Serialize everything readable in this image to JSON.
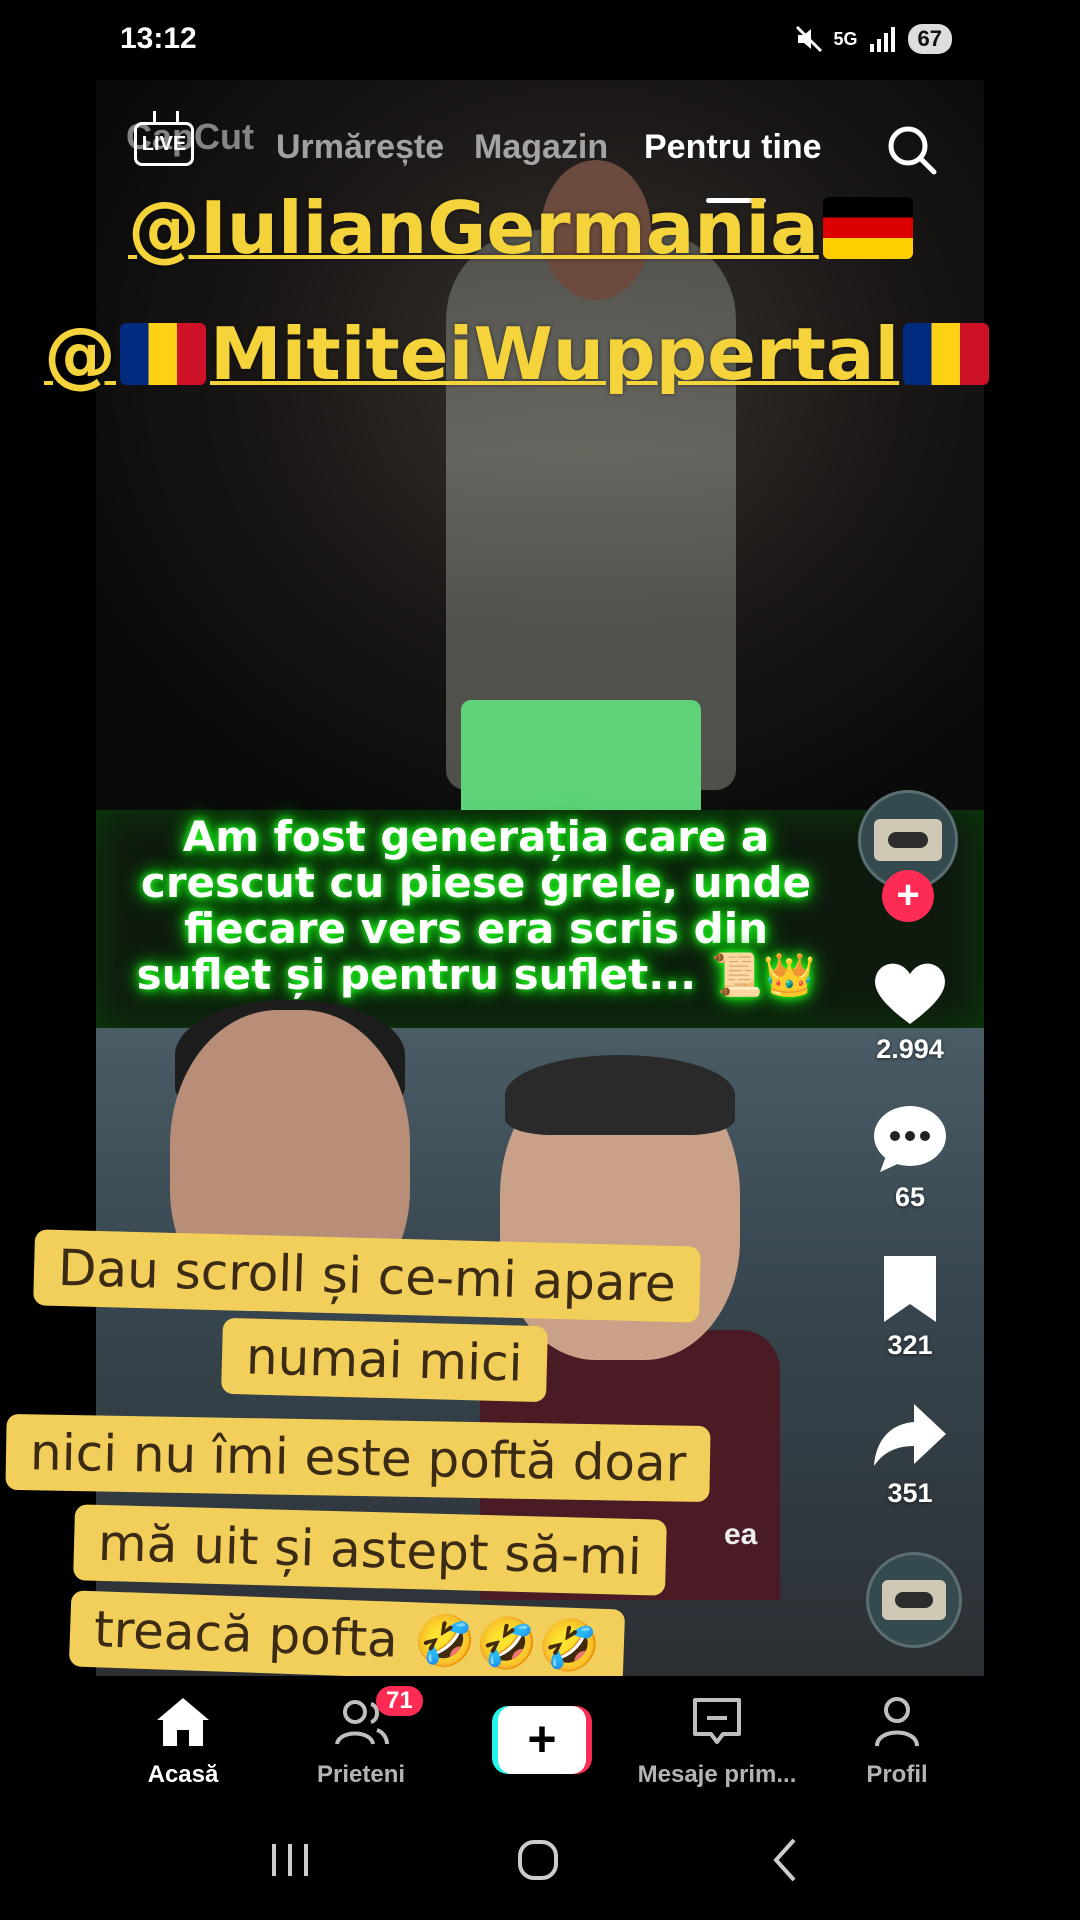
{
  "status_bar": {
    "time": "13:12",
    "network": "5G",
    "battery": "67"
  },
  "top_nav": {
    "watermark": "CapCut",
    "live_label": "LIVE",
    "tabs": [
      {
        "label": "Urmărește"
      },
      {
        "label": "Magazin"
      },
      {
        "label": "Pentru tine",
        "active": true
      }
    ]
  },
  "overlay": {
    "mention1": "@IulianGermania",
    "mention2": "@",
    "mention2_name": "MititeiWuppertal",
    "glow_caption": [
      "Am fost generația care a",
      "crescut cu piese grele, unde",
      "fiecare vers era scris din",
      "suflet și pentru suflet... 📜👑"
    ],
    "partial_text": "ea",
    "yellow_caption": [
      "Dau scroll și ce-mi apare",
      "numai mici",
      "nici nu îmi este poftă doar",
      "mă uit și astept să-mi",
      "treacă pofta 🤣🤣🤣"
    ]
  },
  "rail": {
    "likes": "2.994",
    "comments": "65",
    "saves": "321",
    "shares": "351"
  },
  "bottom_nav": {
    "home": "Acasă",
    "friends": "Prieteni",
    "friends_badge": "71",
    "create": "+",
    "inbox": "Mesaje prim...",
    "profile": "Profil"
  },
  "colors": {
    "accent": "#fe2c55",
    "accent2": "#25f4ee",
    "caption_yellow": "#f2cf5b",
    "mention_yellow": "#f4d33b",
    "glow_green": "#1eff1e"
  }
}
